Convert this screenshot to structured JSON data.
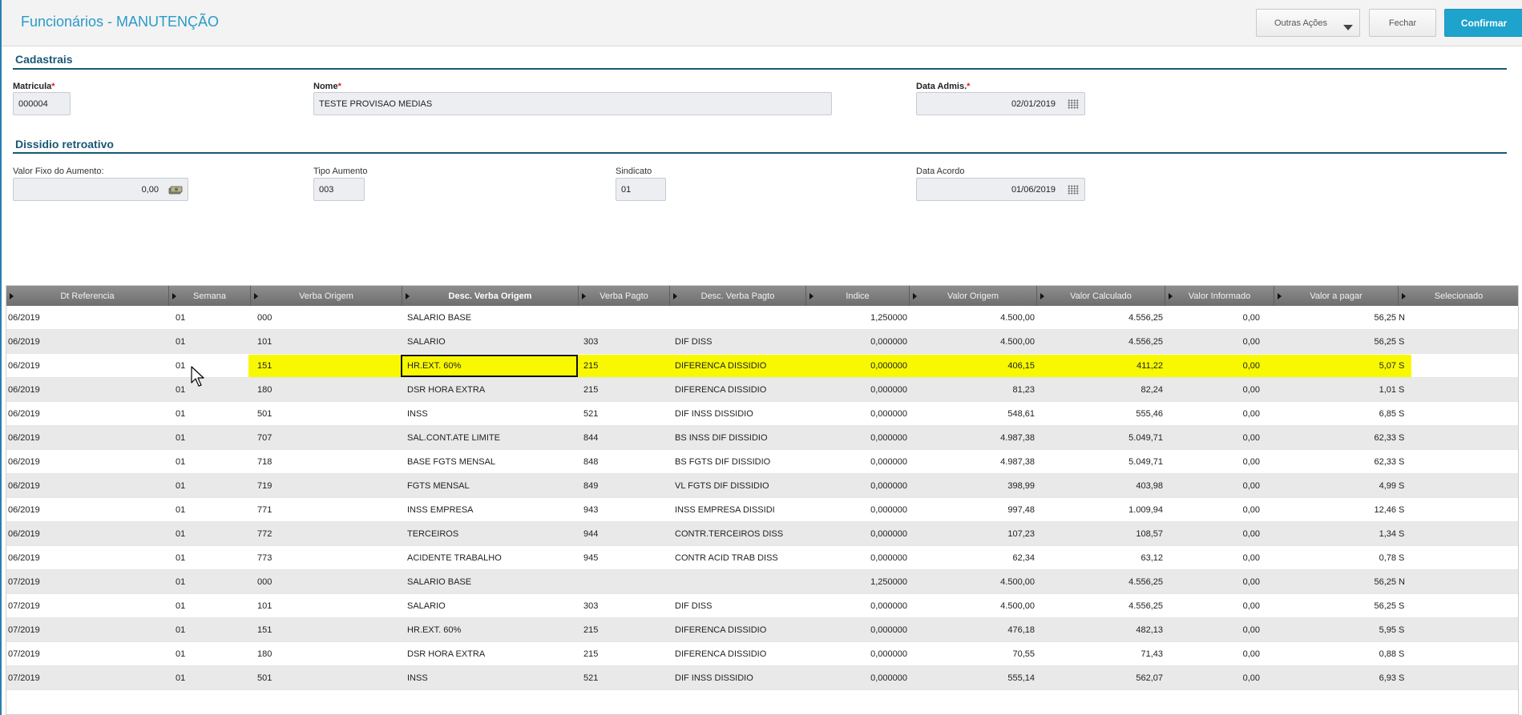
{
  "header": {
    "title": "Funcionários - MANUTENÇÃO",
    "outras_acoes": "Outras Ações",
    "fechar": "Fechar",
    "confirmar": "Confirmar"
  },
  "cadastrais": {
    "section_title": "Cadastrais",
    "matricula_label": "Matricula",
    "matricula_value": "000004",
    "nome_label": "Nome",
    "nome_value": "TESTE PROVISAO MEDIAS",
    "data_admis_label": "Data Admis.",
    "data_admis_value": "02/01/2019",
    "required_mark": "*"
  },
  "dissidio": {
    "section_title": "Dissidio retroativo",
    "valor_fixo_label": "Valor Fixo do Aumento:",
    "valor_fixo_value": "0,00",
    "tipo_aumento_label": "Tipo Aumento",
    "tipo_aumento_value": "003",
    "sindicato_label": "Sindicato",
    "sindicato_value": "01",
    "data_acordo_label": "Data Acordo",
    "data_acordo_value": "01/06/2019"
  },
  "grid": {
    "columns": [
      "Dt Referencia",
      "Semana",
      "Verba Origem",
      "Desc. Verba Origem",
      "Verba Pagto",
      "Desc. Verba Pagto",
      "Indice",
      "Valor Origem",
      "Valor Calculado",
      "Valor Informado",
      "Valor a pagar",
      "Selecionado"
    ],
    "rows": [
      [
        "06/2019",
        "01",
        "000",
        "SALARIO BASE",
        "",
        "",
        "1,250000",
        "4.500,00",
        "4.556,25",
        "0,00",
        "56,25",
        "N"
      ],
      [
        "06/2019",
        "01",
        "101",
        "SALARIO",
        "303",
        "DIF DISS",
        "0,000000",
        "4.500,00",
        "4.556,25",
        "0,00",
        "56,25",
        "S"
      ],
      [
        "06/2019",
        "01",
        "151",
        "HR.EXT.  60%",
        "215",
        "DIFERENCA DISSIDIO",
        "0,000000",
        "406,15",
        "411,22",
        "0,00",
        "5,07",
        "S"
      ],
      [
        "06/2019",
        "01",
        "180",
        "DSR HORA EXTRA",
        "215",
        "DIFERENCA DISSIDIO",
        "0,000000",
        "81,23",
        "82,24",
        "0,00",
        "1,01",
        "S"
      ],
      [
        "06/2019",
        "01",
        "501",
        "INSS",
        "521",
        "DIF INSS DISSIDIO",
        "0,000000",
        "548,61",
        "555,46",
        "0,00",
        "6,85",
        "S"
      ],
      [
        "06/2019",
        "01",
        "707",
        "SAL.CONT.ATE LIMITE",
        "844",
        "BS INSS DIF DISSIDIO",
        "0,000000",
        "4.987,38",
        "5.049,71",
        "0,00",
        "62,33",
        "S"
      ],
      [
        "06/2019",
        "01",
        "718",
        "BASE FGTS MENSAL",
        "848",
        "BS FGTS DIF DISSIDIO",
        "0,000000",
        "4.987,38",
        "5.049,71",
        "0,00",
        "62,33",
        "S"
      ],
      [
        "06/2019",
        "01",
        "719",
        "FGTS MENSAL",
        "849",
        "VL FGTS DIF DISSIDIO",
        "0,000000",
        "398,99",
        "403,98",
        "0,00",
        "4,99",
        "S"
      ],
      [
        "06/2019",
        "01",
        "771",
        "INSS EMPRESA",
        "943",
        "INSS EMPRESA DISSIDI",
        "0,000000",
        "997,48",
        "1.009,94",
        "0,00",
        "12,46",
        "S"
      ],
      [
        "06/2019",
        "01",
        "772",
        "TERCEIROS",
        "944",
        "CONTR.TERCEIROS DISS",
        "0,000000",
        "107,23",
        "108,57",
        "0,00",
        "1,34",
        "S"
      ],
      [
        "06/2019",
        "01",
        "773",
        "ACIDENTE TRABALHO",
        "945",
        "CONTR ACID TRAB DISS",
        "0,000000",
        "62,34",
        "63,12",
        "0,00",
        "0,78",
        "S"
      ],
      [
        "07/2019",
        "01",
        "000",
        "SALARIO BASE",
        "",
        "",
        "1,250000",
        "4.500,00",
        "4.556,25",
        "0,00",
        "56,25",
        "N"
      ],
      [
        "07/2019",
        "01",
        "101",
        "SALARIO",
        "303",
        "DIF DISS",
        "0,000000",
        "4.500,00",
        "4.556,25",
        "0,00",
        "56,25",
        "S"
      ],
      [
        "07/2019",
        "01",
        "151",
        "HR.EXT.  60%",
        "215",
        "DIFERENCA DISSIDIO",
        "0,000000",
        "476,18",
        "482,13",
        "0,00",
        "5,95",
        "S"
      ],
      [
        "07/2019",
        "01",
        "180",
        "DSR HORA EXTRA",
        "215",
        "DIFERENCA DISSIDIO",
        "0,000000",
        "70,55",
        "71,43",
        "0,00",
        "0,88",
        "S"
      ],
      [
        "07/2019",
        "01",
        "501",
        "INSS",
        "521",
        "DIF INSS DISSIDIO",
        "0,000000",
        "555,14",
        "562,07",
        "0,00",
        "6,93",
        "S"
      ]
    ],
    "highlighted_row": 2,
    "highlight_color": "#f8f800"
  },
  "icons": {
    "calendar": "calendar-icon",
    "money": "money-icon",
    "sort": "column-sort-arrow-icon",
    "dropdown": "chevron-down-icon",
    "cursor": "mouse-cursor-icon"
  }
}
